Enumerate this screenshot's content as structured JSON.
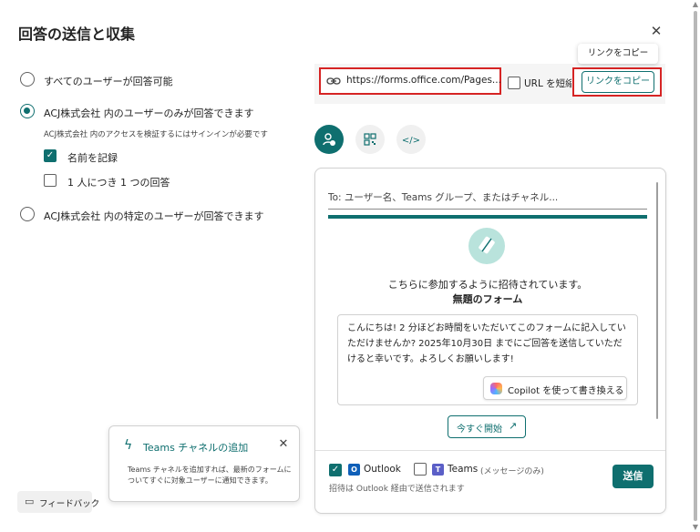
{
  "dialog": {
    "title": "回答の送信と収集",
    "close_icon": "close-icon"
  },
  "response_options": {
    "everyone": {
      "label": "すべてのユーザーが回答可能",
      "selected": false
    },
    "org_only": {
      "label": "ACJ株式会社 内のユーザーのみが回答できます",
      "selected": true,
      "note": "ACJ株式会社 内のアクセスを検証するにはサインインが必要です",
      "record_name": {
        "label": "名前を記録",
        "checked": true
      },
      "one_response": {
        "label": "1 人につき 1 つの回答",
        "checked": false
      }
    },
    "specific_people": {
      "label": "ACJ株式会社 内の特定のユーザーが回答できます",
      "selected": false
    }
  },
  "link_bar": {
    "url": "https://forms.office.com/Pages...",
    "shorten_label": "URL を短縮",
    "shorten_checked": false,
    "copy_button": "リンクをコピー",
    "tooltip": "リンクをコピー"
  },
  "share_modes": [
    {
      "icon": "share-people-icon",
      "selected": true
    },
    {
      "icon": "qr-code-icon",
      "selected": false
    },
    {
      "icon": "embed-code-icon",
      "selected": false
    }
  ],
  "share_panel": {
    "to_placeholder": "To: ユーザー名、Teams グループ、またはチャネル...",
    "invite_text": "こちらに参加するように招待されています。",
    "form_name": "無題のフォーム",
    "message": "こんにちは! 2 分ほどお時間をいただいてこのフォームに記入していただけませんか? 2025年10月30日 までにご回答を送信していただけると幸いです。よろしくお願いします!",
    "copilot_button": "Copilot を使って書き換える",
    "start_button": "今すぐ開始",
    "outlook": {
      "label": "Outlook",
      "checked": true
    },
    "teams": {
      "label": "Teams",
      "suffix": "(メッセージのみ)",
      "checked": false
    },
    "footer_note": "招待は Outlook 経由で送信されます",
    "send_button": "送信"
  },
  "teams_card": {
    "title": "Teams チャネルの追加",
    "body": "Teams チャネルを追加すれば、最新のフォームについてすぐに対象ユーザーに通知できます。"
  },
  "feedback_button": "フィードバック",
  "colors": {
    "accent": "#0f6f6f",
    "highlight": "#d62424"
  }
}
